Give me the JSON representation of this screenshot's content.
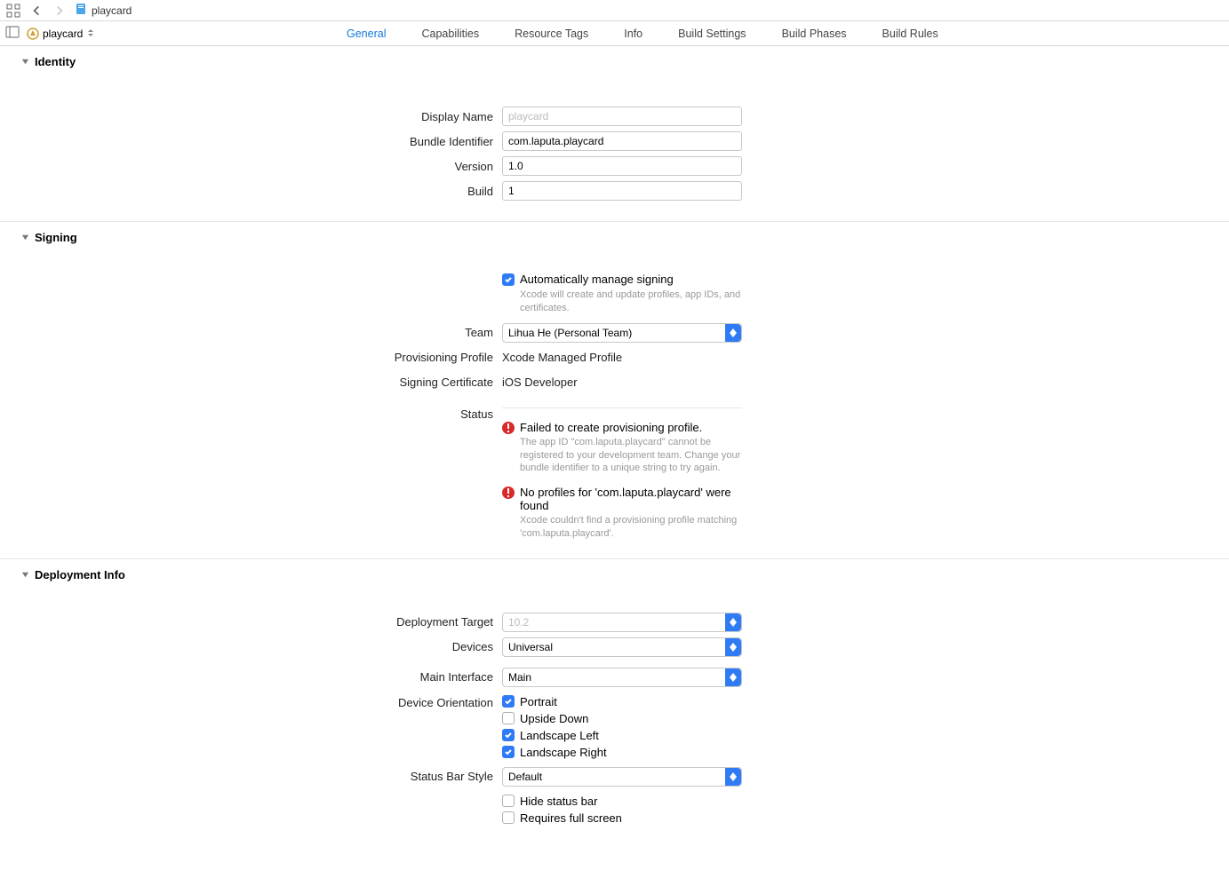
{
  "breadcrumb": {
    "file": "playcard"
  },
  "target": {
    "name": "playcard"
  },
  "tabs": {
    "general": "General",
    "capabilities": "Capabilities",
    "resource_tags": "Resource Tags",
    "info": "Info",
    "build_settings": "Build Settings",
    "build_phases": "Build Phases",
    "build_rules": "Build Rules"
  },
  "identity": {
    "title": "Identity",
    "display_name_label": "Display Name",
    "display_name_placeholder": "playcard",
    "bundle_id_label": "Bundle Identifier",
    "bundle_id_value": "com.laputa.playcard",
    "version_label": "Version",
    "version_value": "1.0",
    "build_label": "Build",
    "build_value": "1"
  },
  "signing": {
    "title": "Signing",
    "auto_label": "Automatically manage signing",
    "auto_help": "Xcode will create and update profiles, app IDs, and certificates.",
    "team_label": "Team",
    "team_value": "Lihua He (Personal Team)",
    "profile_label": "Provisioning Profile",
    "profile_value": "Xcode Managed Profile",
    "cert_label": "Signing Certificate",
    "cert_value": "iOS Developer",
    "status_label": "Status",
    "err1_title": "Failed to create provisioning profile.",
    "err1_msg": "The app ID \"com.laputa.playcard\" cannot be registered to your development team. Change your bundle identifier to a unique string to try again.",
    "err2_title": "No profiles for 'com.laputa.playcard' were found",
    "err2_msg": "Xcode couldn't find a provisioning profile matching 'com.laputa.playcard'."
  },
  "deployment": {
    "title": "Deployment Info",
    "target_label": "Deployment Target",
    "target_value": "10.2",
    "devices_label": "Devices",
    "devices_value": "Universal",
    "main_if_label": "Main Interface",
    "main_if_value": "Main",
    "orient_label": "Device Orientation",
    "orient_portrait": "Portrait",
    "orient_upside": "Upside Down",
    "orient_left": "Landscape Left",
    "orient_right": "Landscape Right",
    "status_bar_label": "Status Bar Style",
    "status_bar_value": "Default",
    "hide_status": "Hide status bar",
    "full_screen": "Requires full screen"
  }
}
